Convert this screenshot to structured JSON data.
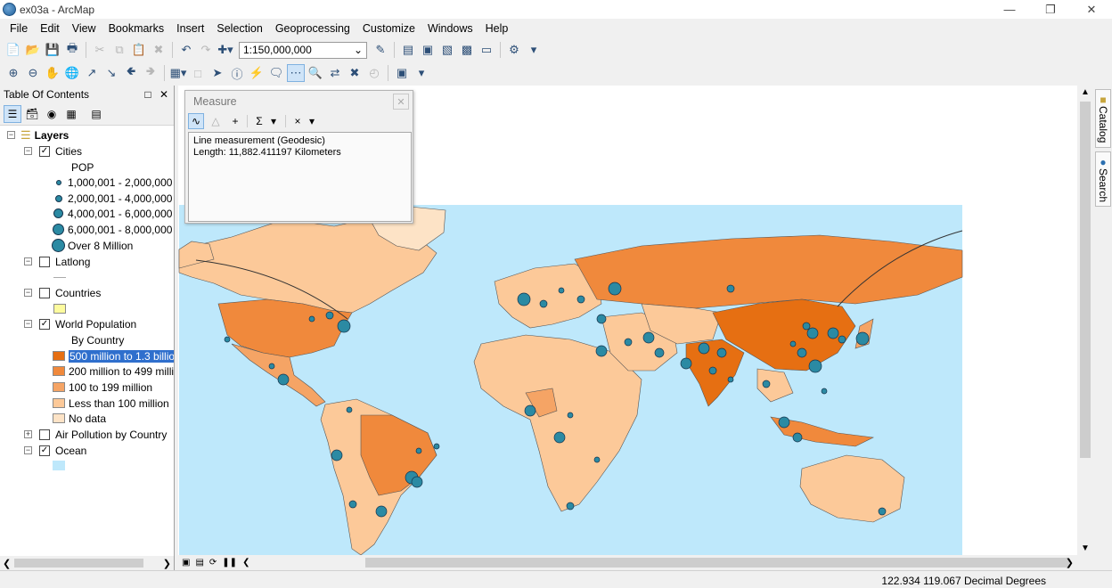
{
  "window": {
    "title": "ex03a - ArcMap"
  },
  "menu": [
    "File",
    "Edit",
    "View",
    "Bookmarks",
    "Insert",
    "Selection",
    "Geoprocessing",
    "Customize",
    "Windows",
    "Help"
  ],
  "toolbar": {
    "scale_value": "1:150,000,000"
  },
  "toc": {
    "title": "Table Of Contents",
    "layers_label": "Layers",
    "cities_label": "Cities",
    "pop_label": "POP",
    "pop_classes": [
      "1,000,001 - 2,000,000",
      "2,000,001 - 4,000,000",
      "4,000,001 - 6,000,000",
      "6,000,001 - 8,000,000",
      "Over 8 Million"
    ],
    "latlong_label": "Latlong",
    "countries_label": "Countries",
    "world_pop_label": "World Population",
    "by_country_label": "By Country",
    "pop_categories": [
      "500 million to 1.3 billio",
      "200 million to 499 milli",
      "100 to 199 million",
      "Less than 100 million",
      "No data"
    ],
    "air_pollution_label": "Air Pollution by Country",
    "ocean_label": "Ocean"
  },
  "colors": {
    "cat1": "#e66f12",
    "cat2": "#f0893c",
    "cat3": "#f5a465",
    "cat4": "#fcc999",
    "nodata": "#fde3c6",
    "countries": "#fdfb9e",
    "ocean": "#bee8fb",
    "city": "#2b8aa3"
  },
  "measure": {
    "title": "Measure",
    "line1": "Line measurement (Geodesic)",
    "line2": "Length: 11,882.411197 Kilometers"
  },
  "dock": {
    "catalog": "Catalog",
    "search": "Search"
  },
  "status": {
    "coords": "122.934  119.067 Decimal Degrees"
  }
}
